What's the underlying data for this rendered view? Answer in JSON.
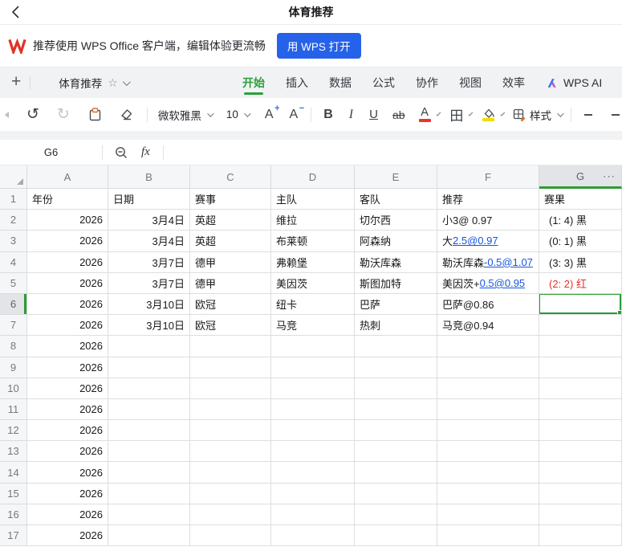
{
  "topbar": {
    "title": "体育推荐"
  },
  "banner": {
    "message": "推荐使用 WPS Office 客户端，编辑体验更流畅",
    "open_button": "用 WPS 打开"
  },
  "menu": {
    "doc_title": "体育推荐",
    "tabs": [
      "开始",
      "插入",
      "数据",
      "公式",
      "协作",
      "视图",
      "效率"
    ],
    "active_tab": "开始",
    "ai_tab": "WPS AI"
  },
  "toolbar": {
    "font_name": "微软雅黑",
    "font_size": "10",
    "bold": "B",
    "italic": "I",
    "underline": "U",
    "strikethrough": "ab",
    "font_color_letter": "A",
    "borders_glyph": "田",
    "style_label": "样式",
    "font_grow": "A",
    "font_shrink": "A"
  },
  "formula_bar": {
    "cell_ref": "G6",
    "fx_label": "fx"
  },
  "grid": {
    "column_letters": [
      "A",
      "B",
      "C",
      "D",
      "E",
      "F",
      "G"
    ],
    "more_button": "···",
    "selected_cell": "G6",
    "selected_row": "6",
    "selected_col": "G",
    "header_cells": [
      "年份",
      "日期",
      "赛事",
      "主队",
      "客队",
      "推荐",
      "赛果"
    ],
    "rows": [
      {
        "num": "2",
        "year": "2026",
        "date": "3月4日",
        "league": "英超",
        "home": "维拉",
        "away": "切尔西",
        "rec_plain": "小3@ 0.97",
        "rec_link": "",
        "result": "(1: 4) 黑",
        "result_red": false,
        "selected": false
      },
      {
        "num": "3",
        "year": "2026",
        "date": "3月4日",
        "league": "英超",
        "home": "布莱顿",
        "away": "阿森纳",
        "rec_plain": "大",
        "rec_link": "2.5@0.97",
        "result": "(0: 1) 黑",
        "result_red": false,
        "selected": false
      },
      {
        "num": "4",
        "year": "2026",
        "date": "3月7日",
        "league": "德甲",
        "home": "弗赖堡",
        "away": "勒沃库森",
        "rec_plain": "勒沃库森",
        "rec_link": "-0.5@1.07",
        "result": "(3: 3) 黑",
        "result_red": false,
        "selected": false
      },
      {
        "num": "5",
        "year": "2026",
        "date": "3月7日",
        "league": "德甲",
        "home": "美因茨",
        "away": "斯图加特",
        "rec_plain": "美因茨+",
        "rec_link": "0.5@0.95",
        "result": "(2: 2) 红",
        "result_red": true,
        "selected": false
      },
      {
        "num": "6",
        "year": "2026",
        "date": "3月10日",
        "league": "欧冠",
        "home": "纽卡",
        "away": "巴萨",
        "rec_plain": "巴萨@0.86",
        "rec_link": "",
        "result": "",
        "result_red": false,
        "selected": true
      },
      {
        "num": "7",
        "year": "2026",
        "date": "3月10日",
        "league": "欧冠",
        "home": "马竞",
        "away": "热刺",
        "rec_plain": "马竞@0.94",
        "rec_link": "",
        "result": "",
        "result_red": false,
        "selected": false
      },
      {
        "num": "8",
        "year": "2026",
        "date": "",
        "league": "",
        "home": "",
        "away": "",
        "rec_plain": "",
        "rec_link": "",
        "result": "",
        "result_red": false,
        "selected": false
      },
      {
        "num": "9",
        "year": "2026",
        "date": "",
        "league": "",
        "home": "",
        "away": "",
        "rec_plain": "",
        "rec_link": "",
        "result": "",
        "result_red": false,
        "selected": false
      },
      {
        "num": "10",
        "year": "2026",
        "date": "",
        "league": "",
        "home": "",
        "away": "",
        "rec_plain": "",
        "rec_link": "",
        "result": "",
        "result_red": false,
        "selected": false
      },
      {
        "num": "11",
        "year": "2026",
        "date": "",
        "league": "",
        "home": "",
        "away": "",
        "rec_plain": "",
        "rec_link": "",
        "result": "",
        "result_red": false,
        "selected": false
      },
      {
        "num": "12",
        "year": "2026",
        "date": "",
        "league": "",
        "home": "",
        "away": "",
        "rec_plain": "",
        "rec_link": "",
        "result": "",
        "result_red": false,
        "selected": false
      },
      {
        "num": "13",
        "year": "2026",
        "date": "",
        "league": "",
        "home": "",
        "away": "",
        "rec_plain": "",
        "rec_link": "",
        "result": "",
        "result_red": false,
        "selected": false
      },
      {
        "num": "14",
        "year": "2026",
        "date": "",
        "league": "",
        "home": "",
        "away": "",
        "rec_plain": "",
        "rec_link": "",
        "result": "",
        "result_red": false,
        "selected": false
      },
      {
        "num": "15",
        "year": "2026",
        "date": "",
        "league": "",
        "home": "",
        "away": "",
        "rec_plain": "",
        "rec_link": "",
        "result": "",
        "result_red": false,
        "selected": false
      },
      {
        "num": "16",
        "year": "2026",
        "date": "",
        "league": "",
        "home": "",
        "away": "",
        "rec_plain": "",
        "rec_link": "",
        "result": "",
        "result_red": false,
        "selected": false
      },
      {
        "num": "17",
        "year": "2026",
        "date": "",
        "league": "",
        "home": "",
        "away": "",
        "rec_plain": "",
        "rec_link": "",
        "result": "",
        "result_red": false,
        "selected": false
      }
    ]
  },
  "colors": {
    "accent_green": "#2E9B35",
    "tab_green": "#2BA03C",
    "link_blue": "#1556E0",
    "result_red": "#ED2D26",
    "button_blue": "#2562E9",
    "wps_red": "#E03426"
  }
}
